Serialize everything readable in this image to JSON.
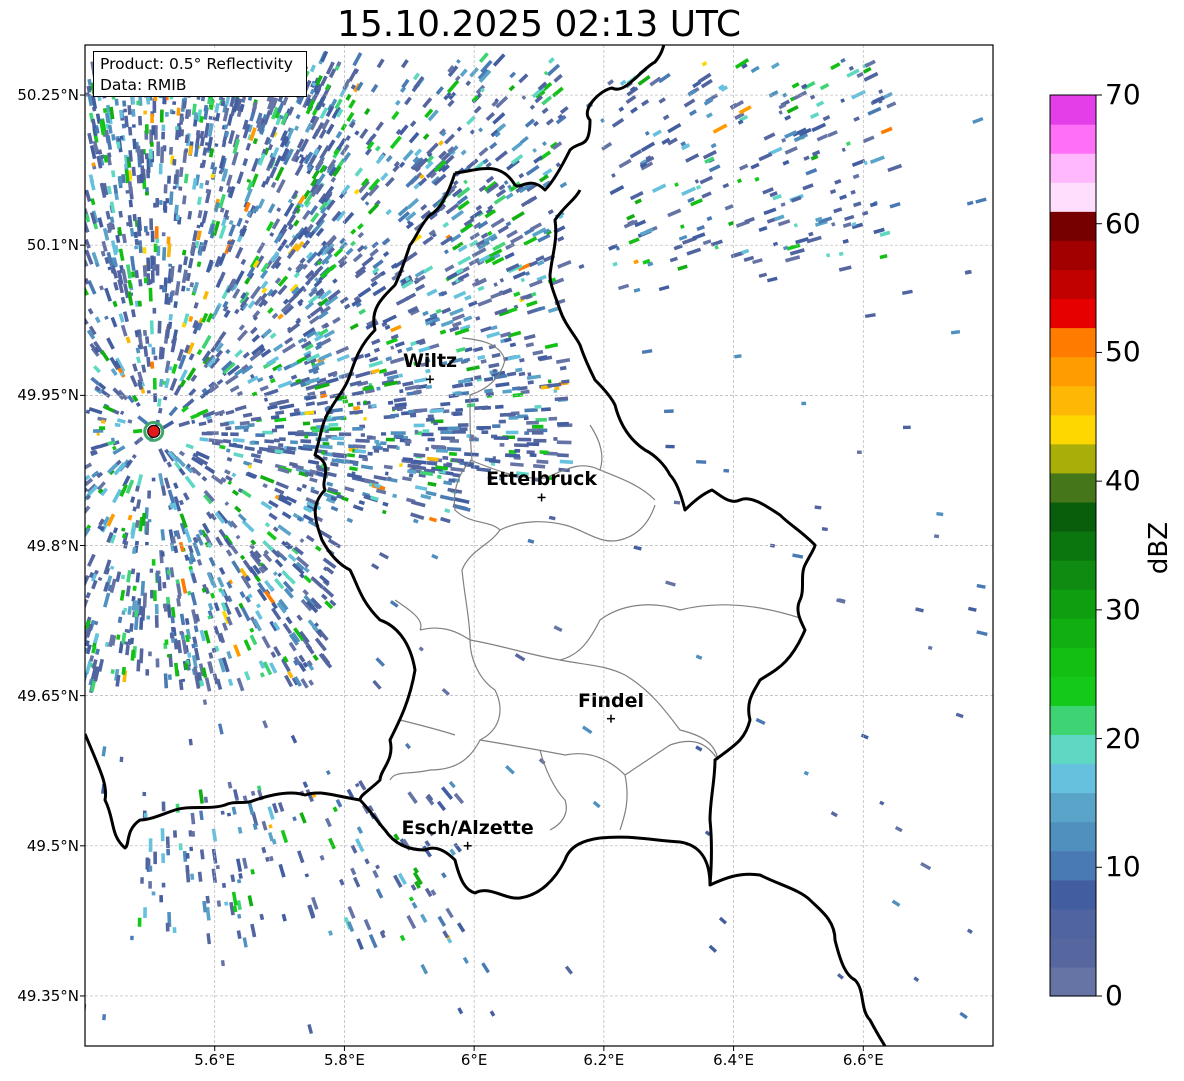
{
  "title": "15.10.2025 02:13 UTC",
  "info_box": {
    "line1": "Product: 0.5° Reflectivity",
    "line2": "Data: RMIB"
  },
  "map": {
    "lon_range": [
      5.4,
      6.8
    ],
    "lat_range": [
      49.3,
      50.3
    ],
    "lat_ticks": [
      {
        "value": 50.25,
        "label": "50.25°N"
      },
      {
        "value": 50.1,
        "label": "50.1°N"
      },
      {
        "value": 49.95,
        "label": "49.95°N"
      },
      {
        "value": 49.8,
        "label": "49.8°N"
      },
      {
        "value": 49.65,
        "label": "49.65°N"
      },
      {
        "value": 49.5,
        "label": "49.5°N"
      },
      {
        "value": 49.35,
        "label": "49.35°N"
      }
    ],
    "lon_ticks": [
      {
        "value": 5.6,
        "label": "5.6°E"
      },
      {
        "value": 5.8,
        "label": "5.8°E"
      },
      {
        "value": 6.0,
        "label": "6°E"
      },
      {
        "value": 6.2,
        "label": "6.2°E"
      },
      {
        "value": 6.4,
        "label": "6.4°E"
      },
      {
        "value": 6.6,
        "label": "6.6°E"
      }
    ],
    "grid": true,
    "radar_site": {
      "lon": 5.506,
      "lat": 49.914,
      "marker_color": "#e31a1c"
    },
    "cities": [
      {
        "name": "Wiltz",
        "lon": 5.932,
        "lat": 49.966
      },
      {
        "name": "Ettelbruck",
        "lon": 6.104,
        "lat": 49.848
      },
      {
        "name": "Findel",
        "lon": 6.211,
        "lat": 49.627
      },
      {
        "name": "Esch/Alzette",
        "lon": 5.99,
        "lat": 49.5
      }
    ]
  },
  "colorbar": {
    "label": "dBZ",
    "min": 0,
    "max": 70,
    "step": 2.5,
    "ticks": [
      "0",
      "10",
      "20",
      "30",
      "40",
      "50",
      "60",
      "70"
    ],
    "colors": [
      "#6574a5",
      "#56669f",
      "#4f64a0",
      "#435ea0",
      "#4a7ab3",
      "#4f90bf",
      "#5aa3c9",
      "#66c1de",
      "#5fd8c3",
      "#3fd473",
      "#15c91a",
      "#14bf14",
      "#11af11",
      "#0f9e0f",
      "#0e8b10",
      "#0c760e",
      "#085e0a",
      "#46761a",
      "#aaae08",
      "#ffd700",
      "#fdb805",
      "#fe9c00",
      "#ff7c00",
      "#e60000",
      "#c10000",
      "#a20000",
      "#760000",
      "#fddffd",
      "#ffb8fc",
      "#ff6ff8",
      "#e43ee8"
    ]
  }
}
